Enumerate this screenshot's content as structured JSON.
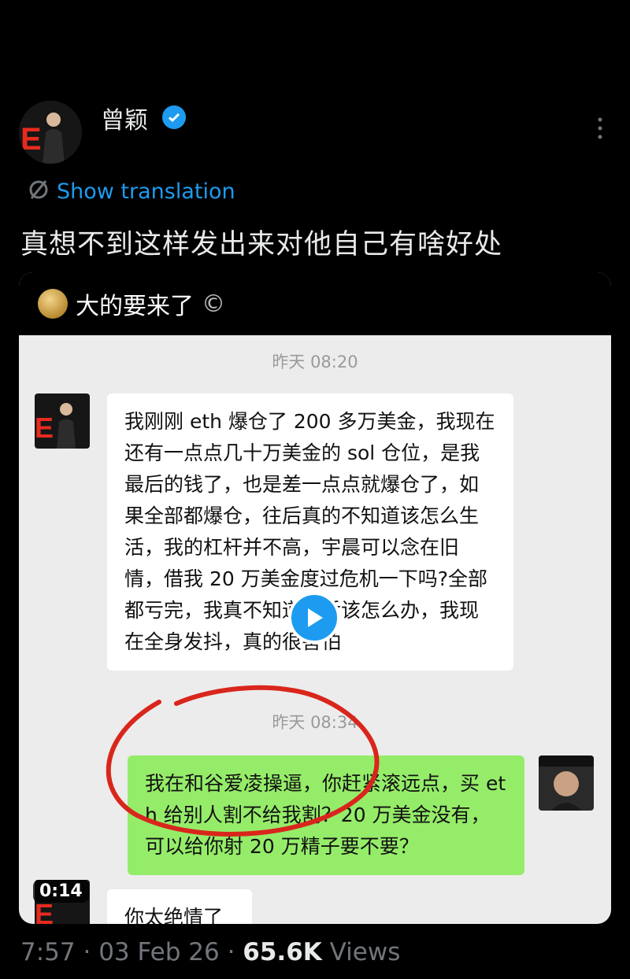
{
  "tweet": {
    "author_name": "曾颖",
    "show_translation": "Show translation",
    "text": "真想不到这样发出来对他自己有啥好处",
    "time": "7:57",
    "separator": "·",
    "date": "03 Feb 26",
    "views_count": "65.6K",
    "views_label": "Views"
  },
  "video": {
    "duration": "0:14"
  },
  "chat": {
    "title": "大的要来了",
    "title_suffix": "©",
    "messages": [
      {
        "type": "time",
        "text": "昨天 08:20"
      },
      {
        "type": "incoming",
        "text": "我刚刚 eth 爆仓了 200 多万美金，我现在还有一点点几十万美金的 sol 仓位，是我最后的钱了，也是差一点点就爆仓了，如果全部都爆仓，往后真的不知道该怎么生活，我的杠杆并不高，宇晨可以念在旧情，借我 20 万美金度过危机一下吗?全部都亏完，我真不知道以后该怎么办，我现在全身发抖，真的很害怕"
      },
      {
        "type": "time",
        "text": "昨天 08:34"
      },
      {
        "type": "outgoing",
        "text": "我在和谷爱凌操逼，你赶紧滚远点，买 eth 给别人割不给我割？20 万美金没有，可以给你射 20 万精子要不要？"
      },
      {
        "type": "incoming",
        "text": "你太绝情了"
      }
    ]
  },
  "colors": {
    "accent": "#1d9bf0",
    "wechat_green": "#95ec69",
    "annotation_red": "#d9261c"
  }
}
